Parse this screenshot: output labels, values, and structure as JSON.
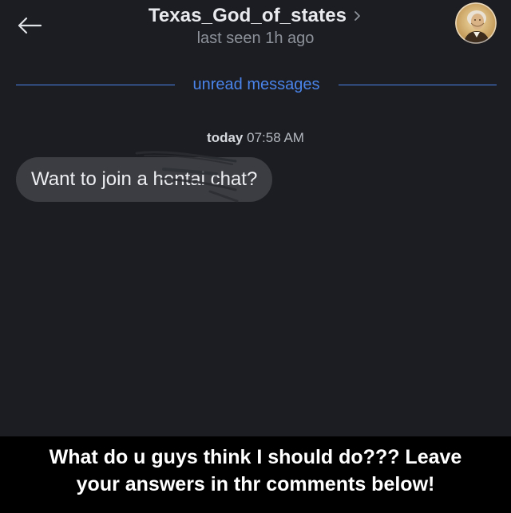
{
  "header": {
    "contact_name": "Texas_God_of_states",
    "last_seen": "last seen 1h ago"
  },
  "divider": {
    "label": "unread messages",
    "color": "#4a84ea"
  },
  "chat": {
    "timestamp_day": "today",
    "timestamp_time": "07:58 AM",
    "messages": [
      {
        "text": "Want to join a hentai chat?",
        "direction": "incoming"
      }
    ]
  },
  "caption": {
    "line1": "What do u guys think I should do??? Leave",
    "line2": "your answers in thr comments below!"
  },
  "icons": {
    "back": "arrow-left-icon",
    "chevron": "chevron-right-icon",
    "avatar": "portrait-avatar"
  },
  "colors": {
    "background": "#1b1d22",
    "bubble": "#3b3d42",
    "accent": "#4a84ea",
    "caption_background": "#000000"
  }
}
